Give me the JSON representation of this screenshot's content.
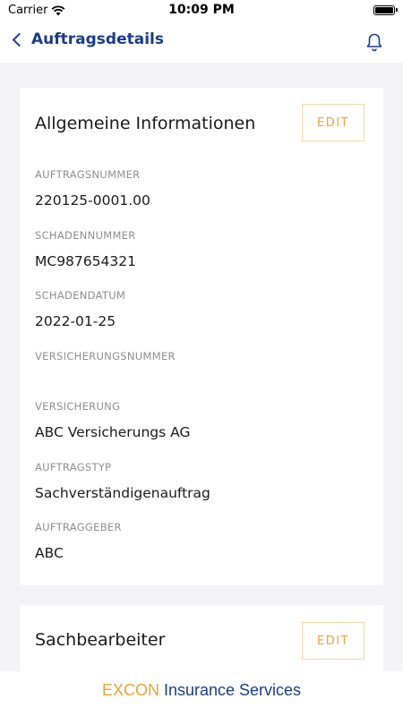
{
  "status_bar": {
    "carrier": "Carrier",
    "time": "10:09 PM"
  },
  "nav": {
    "back_label": "Auftragsdetails"
  },
  "general_card": {
    "title": "Allgemeine Informationen",
    "edit_label": "EDIT",
    "fields": [
      {
        "label": "AUFTRAGSNUMMER",
        "value": "220125-0001.00"
      },
      {
        "label": "SCHADENNUMMER",
        "value": "MC987654321"
      },
      {
        "label": "SCHADENDATUM",
        "value": "2022-01-25"
      },
      {
        "label": "VERSICHERUNGSNUMMER",
        "value": ""
      },
      {
        "label": "VERSICHERUNG",
        "value": "ABC Versicherungs AG"
      },
      {
        "label": "AUFTRAGSTYP",
        "value": "Sachverständigenauftrag"
      },
      {
        "label": "AUFTRAGGEBER",
        "value": "ABC"
      }
    ]
  },
  "handler_card": {
    "title": "Sachbearbeiter",
    "edit_label": "EDIT"
  },
  "footer": {
    "brand": "EXCON",
    "name": "Insurance Services"
  },
  "colors": {
    "accent": "#e8a33a",
    "primary": "#1d3b8a",
    "background": "#f2f2f7"
  }
}
